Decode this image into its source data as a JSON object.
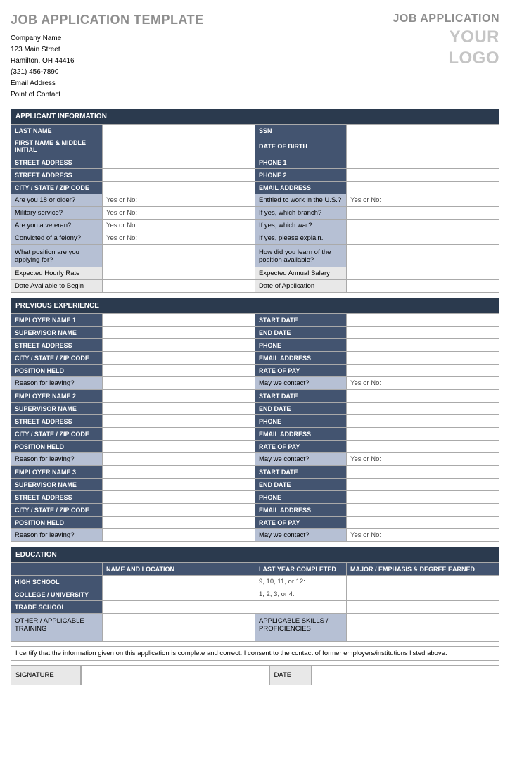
{
  "header": {
    "title": "JOB APPLICATION TEMPLATE",
    "company": "Company Name",
    "street": "123 Main Street",
    "citystate": "Hamilton, OH 44416",
    "phone": "(321) 456-7890",
    "email": "Email Address",
    "poc": "Point of Contact",
    "app_label": "JOB APPLICATION",
    "logo1": "YOUR",
    "logo2": "LOGO"
  },
  "sec1": {
    "hdr": "APPLICANT INFORMATION",
    "lastname": "LAST NAME",
    "ssn": "SSN",
    "firstname": "FIRST NAME & MIDDLE INITIAL",
    "dob": "DATE OF BIRTH",
    "street1": "STREET ADDRESS",
    "phone1": "PHONE 1",
    "street2": "STREET ADDRESS",
    "phone2": "PHONE 2",
    "csz": "CITY / STATE / ZIP CODE",
    "email": "EMAIL ADDRESS",
    "age18": "Are you 18 or older?",
    "yesno": "Yes or No:",
    "entitled": "Entitled to work in the U.S.?",
    "military": "Military service?",
    "branch": "If yes, which branch?",
    "veteran": "Are you a veteran?",
    "war": "If yes, which war?",
    "felony": "Convicted of a felony?",
    "explain": "If yes, please explain.",
    "position": "What position are you applying for?",
    "learn": "How did you learn of the position available?",
    "hourly": "Expected Hourly Rate",
    "salary": "Expected Annual Salary",
    "avail": "Date Available to Begin",
    "appdate": "Date of Application"
  },
  "sec2": {
    "hdr": "PREVIOUS EXPERIENCE",
    "emp1": "EMPLOYER NAME 1",
    "emp2": "EMPLOYER NAME 2",
    "emp3": "EMPLOYER NAME 3",
    "sup": "SUPERVISOR NAME",
    "start": "START DATE",
    "end": "END DATE",
    "street": "STREET ADDRESS",
    "phone": "PHONE",
    "csz": "CITY / STATE / ZIP CODE",
    "email": "EMAIL ADDRESS",
    "posheld": "POSITION HELD",
    "rate": "RATE OF PAY",
    "reason": "Reason for leaving?",
    "contact": "May we contact?",
    "yesno": "Yes or No:"
  },
  "sec3": {
    "hdr": "EDUCATION",
    "nameloc": "NAME AND LOCATION",
    "lastyear": "LAST YEAR COMPLETED",
    "major": "MAJOR / EMPHASIS & DEGREE EARNED",
    "hs": "HIGH SCHOOL",
    "hs_val": "9, 10, 11, or 12:",
    "college": "COLLEGE / UNIVERSITY",
    "col_val": "1, 2, 3, or 4:",
    "trade": "TRADE SCHOOL",
    "other": "OTHER / APPLICABLE TRAINING",
    "skills": "APPLICABLE SKILLS / PROFICIENCIES"
  },
  "cert": "I certify that the information given on this application is complete and correct. I consent to the contact of former employers/institutions listed above.",
  "sig": {
    "signature": "SIGNATURE",
    "date": "DATE"
  }
}
